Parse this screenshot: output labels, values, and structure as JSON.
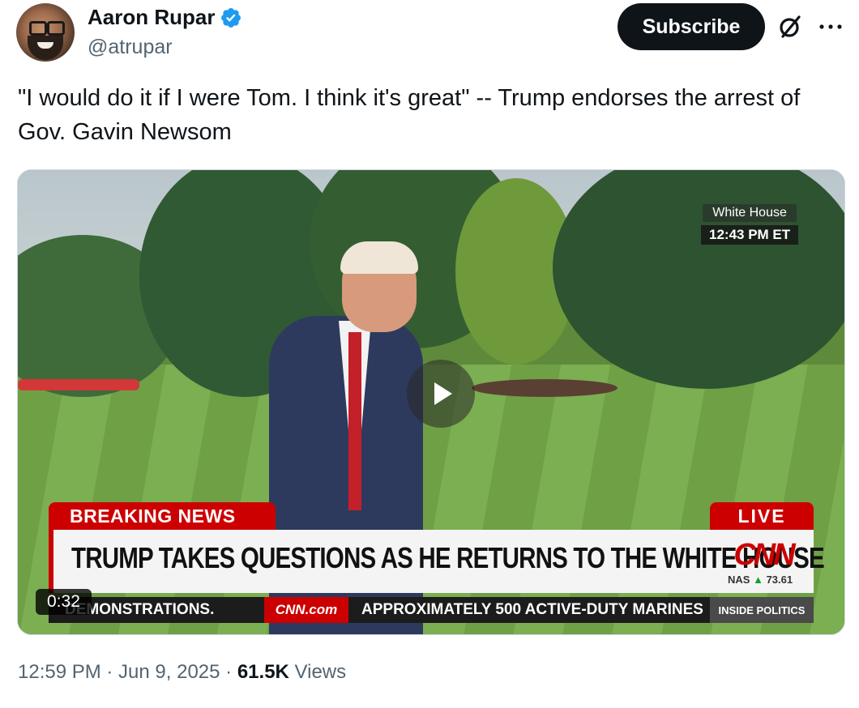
{
  "author": {
    "display_name": "Aaron Rupar",
    "handle": "@atrupar",
    "verified_icon": "verified-badge-icon",
    "verified_color": "#1d9bf0"
  },
  "actions": {
    "subscribe_label": "Subscribe",
    "grok_icon": "grok-icon",
    "more_icon": "more-icon"
  },
  "tweet": {
    "text": "\"I would do it if I were Tom. I think it's great\" -- Trump endorses the arrest of Gov. Gavin Newsom"
  },
  "video": {
    "duration": "0:32",
    "play_icon": "play-icon",
    "location_bug": "White House",
    "time_bug": "12:43 PM ET",
    "breaking_label": "BREAKING NEWS",
    "live_label": "LIVE",
    "headline": "TRUMP TAKES QUESTIONS AS HE RETURNS TO THE WHITE HOUSE",
    "network_logo": "CNN",
    "stock_label": "NAS",
    "stock_value": "73.61",
    "ticker_left": "DEMONSTRATIONS.",
    "ticker_site": "CNN.com",
    "ticker_right": "APPROXIMATELY 500 ACTIVE-DUTY MARINES",
    "show_name": "INSIDE POLITICS",
    "brand_red": "#cc0000"
  },
  "meta": {
    "timestamp": "12:59 PM · Jun 9, 2025 · ",
    "views_count": "61.5K",
    "views_label": " Views"
  }
}
